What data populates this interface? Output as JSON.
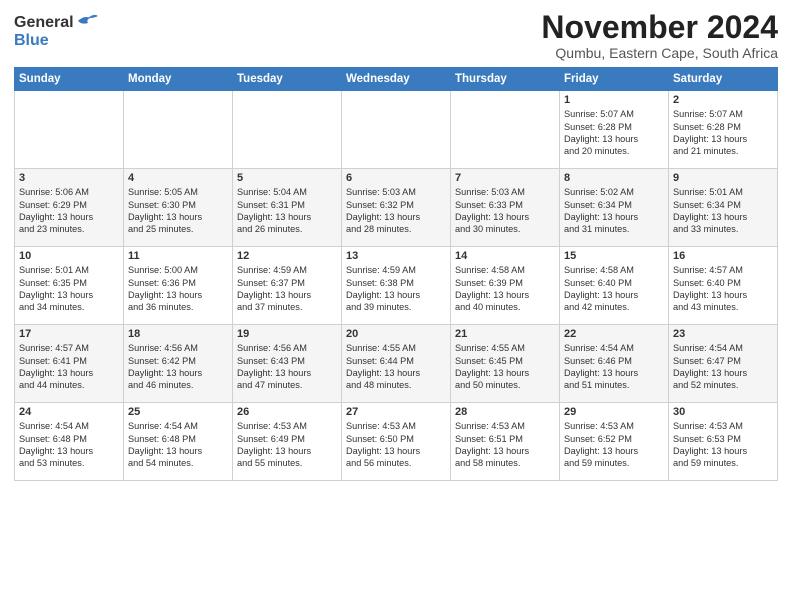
{
  "header": {
    "logo_general": "General",
    "logo_blue": "Blue",
    "month_title": "November 2024",
    "location": "Qumbu, Eastern Cape, South Africa"
  },
  "days_of_week": [
    "Sunday",
    "Monday",
    "Tuesday",
    "Wednesday",
    "Thursday",
    "Friday",
    "Saturday"
  ],
  "weeks": [
    [
      {
        "day": "",
        "content": ""
      },
      {
        "day": "",
        "content": ""
      },
      {
        "day": "",
        "content": ""
      },
      {
        "day": "",
        "content": ""
      },
      {
        "day": "",
        "content": ""
      },
      {
        "day": "1",
        "content": "Sunrise: 5:07 AM\nSunset: 6:28 PM\nDaylight: 13 hours\nand 20 minutes."
      },
      {
        "day": "2",
        "content": "Sunrise: 5:07 AM\nSunset: 6:28 PM\nDaylight: 13 hours\nand 21 minutes."
      }
    ],
    [
      {
        "day": "3",
        "content": "Sunrise: 5:06 AM\nSunset: 6:29 PM\nDaylight: 13 hours\nand 23 minutes."
      },
      {
        "day": "4",
        "content": "Sunrise: 5:05 AM\nSunset: 6:30 PM\nDaylight: 13 hours\nand 25 minutes."
      },
      {
        "day": "5",
        "content": "Sunrise: 5:04 AM\nSunset: 6:31 PM\nDaylight: 13 hours\nand 26 minutes."
      },
      {
        "day": "6",
        "content": "Sunrise: 5:03 AM\nSunset: 6:32 PM\nDaylight: 13 hours\nand 28 minutes."
      },
      {
        "day": "7",
        "content": "Sunrise: 5:03 AM\nSunset: 6:33 PM\nDaylight: 13 hours\nand 30 minutes."
      },
      {
        "day": "8",
        "content": "Sunrise: 5:02 AM\nSunset: 6:34 PM\nDaylight: 13 hours\nand 31 minutes."
      },
      {
        "day": "9",
        "content": "Sunrise: 5:01 AM\nSunset: 6:34 PM\nDaylight: 13 hours\nand 33 minutes."
      }
    ],
    [
      {
        "day": "10",
        "content": "Sunrise: 5:01 AM\nSunset: 6:35 PM\nDaylight: 13 hours\nand 34 minutes."
      },
      {
        "day": "11",
        "content": "Sunrise: 5:00 AM\nSunset: 6:36 PM\nDaylight: 13 hours\nand 36 minutes."
      },
      {
        "day": "12",
        "content": "Sunrise: 4:59 AM\nSunset: 6:37 PM\nDaylight: 13 hours\nand 37 minutes."
      },
      {
        "day": "13",
        "content": "Sunrise: 4:59 AM\nSunset: 6:38 PM\nDaylight: 13 hours\nand 39 minutes."
      },
      {
        "day": "14",
        "content": "Sunrise: 4:58 AM\nSunset: 6:39 PM\nDaylight: 13 hours\nand 40 minutes."
      },
      {
        "day": "15",
        "content": "Sunrise: 4:58 AM\nSunset: 6:40 PM\nDaylight: 13 hours\nand 42 minutes."
      },
      {
        "day": "16",
        "content": "Sunrise: 4:57 AM\nSunset: 6:40 PM\nDaylight: 13 hours\nand 43 minutes."
      }
    ],
    [
      {
        "day": "17",
        "content": "Sunrise: 4:57 AM\nSunset: 6:41 PM\nDaylight: 13 hours\nand 44 minutes."
      },
      {
        "day": "18",
        "content": "Sunrise: 4:56 AM\nSunset: 6:42 PM\nDaylight: 13 hours\nand 46 minutes."
      },
      {
        "day": "19",
        "content": "Sunrise: 4:56 AM\nSunset: 6:43 PM\nDaylight: 13 hours\nand 47 minutes."
      },
      {
        "day": "20",
        "content": "Sunrise: 4:55 AM\nSunset: 6:44 PM\nDaylight: 13 hours\nand 48 minutes."
      },
      {
        "day": "21",
        "content": "Sunrise: 4:55 AM\nSunset: 6:45 PM\nDaylight: 13 hours\nand 50 minutes."
      },
      {
        "day": "22",
        "content": "Sunrise: 4:54 AM\nSunset: 6:46 PM\nDaylight: 13 hours\nand 51 minutes."
      },
      {
        "day": "23",
        "content": "Sunrise: 4:54 AM\nSunset: 6:47 PM\nDaylight: 13 hours\nand 52 minutes."
      }
    ],
    [
      {
        "day": "24",
        "content": "Sunrise: 4:54 AM\nSunset: 6:48 PM\nDaylight: 13 hours\nand 53 minutes."
      },
      {
        "day": "25",
        "content": "Sunrise: 4:54 AM\nSunset: 6:48 PM\nDaylight: 13 hours\nand 54 minutes."
      },
      {
        "day": "26",
        "content": "Sunrise: 4:53 AM\nSunset: 6:49 PM\nDaylight: 13 hours\nand 55 minutes."
      },
      {
        "day": "27",
        "content": "Sunrise: 4:53 AM\nSunset: 6:50 PM\nDaylight: 13 hours\nand 56 minutes."
      },
      {
        "day": "28",
        "content": "Sunrise: 4:53 AM\nSunset: 6:51 PM\nDaylight: 13 hours\nand 58 minutes."
      },
      {
        "day": "29",
        "content": "Sunrise: 4:53 AM\nSunset: 6:52 PM\nDaylight: 13 hours\nand 59 minutes."
      },
      {
        "day": "30",
        "content": "Sunrise: 4:53 AM\nSunset: 6:53 PM\nDaylight: 13 hours\nand 59 minutes."
      }
    ]
  ]
}
